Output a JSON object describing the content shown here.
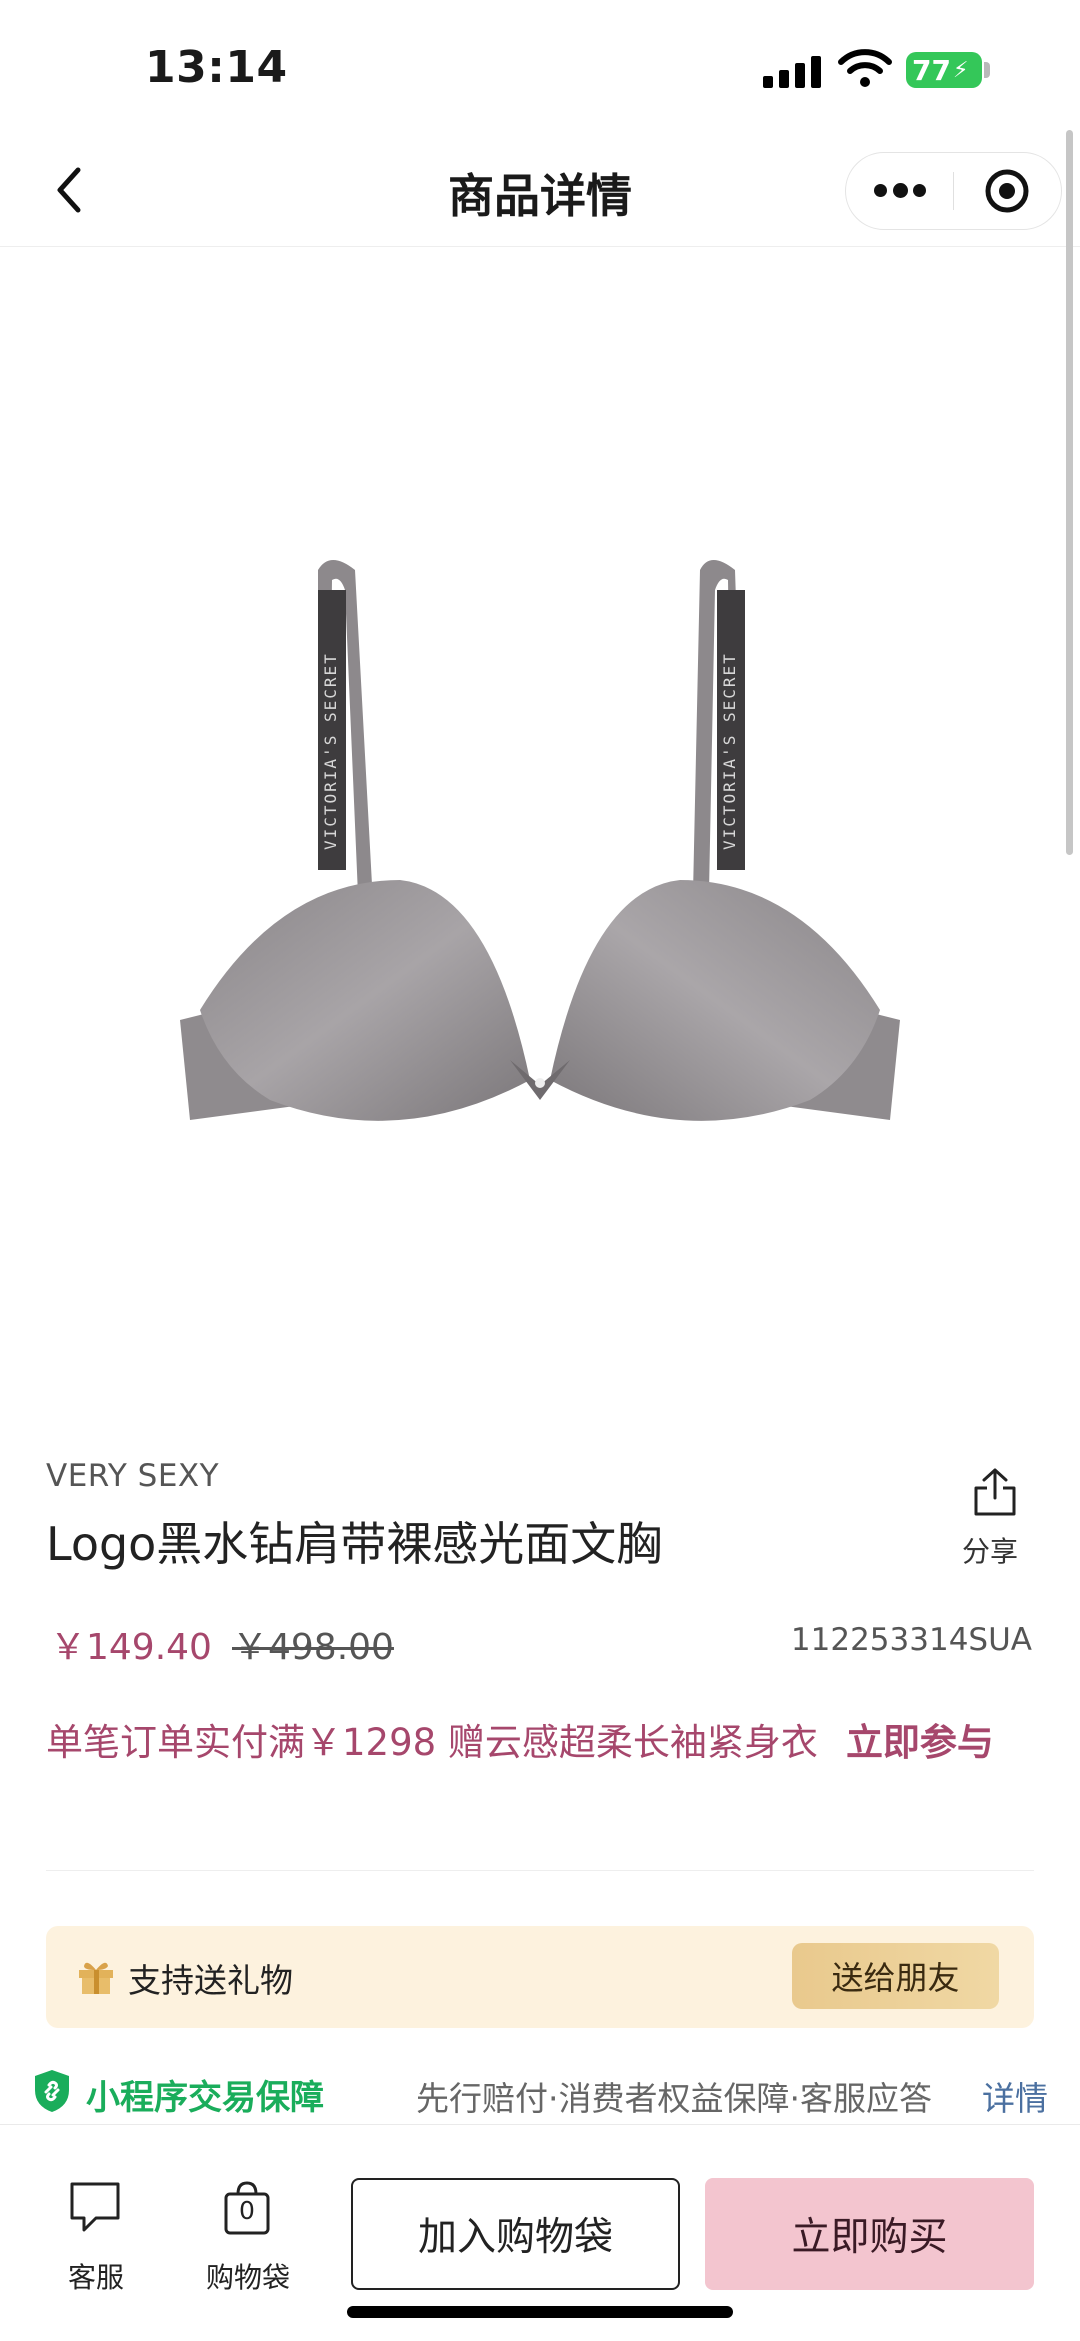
{
  "status_bar": {
    "time": "13:14",
    "battery": "77"
  },
  "nav": {
    "title": "商品详情"
  },
  "product": {
    "brand": "VERY SEXY",
    "name": "Logo黑水钻肩带裸感光面文胸",
    "price": "￥149.40",
    "original_price": "￥498.00",
    "sku": "112253314SUA",
    "share_label": "分享",
    "strap_text": "VICTORIA'S SECRET"
  },
  "promo": {
    "text": "单笔订单实付满￥1298 赠云感超柔长袖紧身衣",
    "cta": "立即参与"
  },
  "gift": {
    "label": "支持送礼物",
    "button": "送给朋友"
  },
  "guarantee": {
    "label": "小程序交易保障",
    "description": "先行赔付·消费者权益保障·客服应答",
    "detail": "详情"
  },
  "bottom_bar": {
    "service_label": "客服",
    "bag_label": "购物袋",
    "bag_count": "0",
    "add_to_bag": "加入购物袋",
    "buy_now": "立即购买"
  },
  "colors": {
    "accent_price": "#a6476c",
    "buy_button": "#f3c5cf",
    "gift_bg": "#fdf2de",
    "guarantee_green": "#1aad5b",
    "link_blue": "#4b70a0"
  },
  "icons": [
    "back-icon",
    "more-icon",
    "target-icon",
    "share-icon",
    "gift-icon",
    "shield-icon",
    "chat-icon",
    "bag-icon"
  ]
}
